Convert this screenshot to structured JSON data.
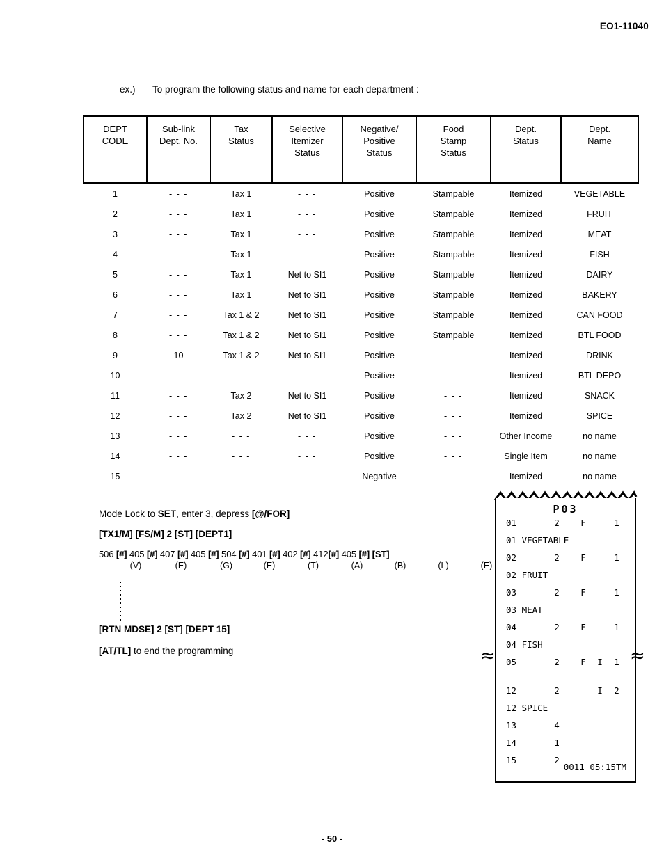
{
  "header": {
    "doc_code": "EO1-11040"
  },
  "intro": {
    "label": "ex.)",
    "text": "To program the following status and name for each department :"
  },
  "table": {
    "columns": [
      {
        "lines": [
          "DEPT",
          "CODE"
        ]
      },
      {
        "lines": [
          "Sub-link",
          "Dept. No."
        ]
      },
      {
        "lines": [
          "Tax",
          "Status"
        ]
      },
      {
        "lines": [
          "Selective",
          "Itemizer",
          "Status"
        ]
      },
      {
        "lines": [
          "Negative/",
          "Positive",
          "Status"
        ]
      },
      {
        "lines": [
          "Food",
          "Stamp",
          "Status"
        ]
      },
      {
        "lines": [
          "Dept.",
          "Status"
        ]
      },
      {
        "lines": [
          "Dept.",
          "Name"
        ]
      }
    ],
    "rows": [
      [
        "1",
        "- - -",
        "Tax 1",
        "- - -",
        "Positive",
        "Stampable",
        "Itemized",
        "VEGETABLE"
      ],
      [
        "2",
        "- - -",
        "Tax 1",
        "- - -",
        "Positive",
        "Stampable",
        "Itemized",
        "FRUIT"
      ],
      [
        "3",
        "- - -",
        "Tax 1",
        "- - -",
        "Positive",
        "Stampable",
        "Itemized",
        "MEAT"
      ],
      [
        "4",
        "- - -",
        "Tax 1",
        "- - -",
        "Positive",
        "Stampable",
        "Itemized",
        "FISH"
      ],
      [
        "5",
        "- - -",
        "Tax 1",
        "Net to SI1",
        "Positive",
        "Stampable",
        "Itemized",
        "DAIRY"
      ],
      [
        "6",
        "- - -",
        "Tax 1",
        "Net to SI1",
        "Positive",
        "Stampable",
        "Itemized",
        "BAKERY"
      ],
      [
        "7",
        "- - -",
        "Tax 1 & 2",
        "Net to SI1",
        "Positive",
        "Stampable",
        "Itemized",
        "CAN FOOD"
      ],
      [
        "8",
        "- - -",
        "Tax 1 & 2",
        "Net to SI1",
        "Positive",
        "Stampable",
        "Itemized",
        "BTL FOOD"
      ],
      [
        "9",
        "10",
        "Tax 1 & 2",
        "Net to SI1",
        "Positive",
        "- - -",
        "Itemized",
        "DRINK"
      ],
      [
        "10",
        "- - -",
        "- - -",
        "- - -",
        "Positive",
        "- - -",
        "Itemized",
        "BTL DEPO"
      ],
      [
        "11",
        "- - -",
        "Tax 2",
        "Net to SI1",
        "Positive",
        "- - -",
        "Itemized",
        "SNACK"
      ],
      [
        "12",
        "- - -",
        "Tax 2",
        "Net to SI1",
        "Positive",
        "- - -",
        "Itemized",
        "SPICE"
      ],
      [
        "13",
        "- - -",
        "- - -",
        "- - -",
        "Positive",
        "- - -",
        "Other Income",
        "no name"
      ],
      [
        "14",
        "- - -",
        "- - -",
        "- - -",
        "Positive",
        "- - -",
        "Single Item",
        "no name"
      ],
      [
        "15",
        "- - -",
        "- - -",
        "- - -",
        "Negative",
        "- - -",
        "Itemized",
        "no name"
      ]
    ]
  },
  "procedure": {
    "line1_prefix": "Mode Lock to ",
    "line1_bold1": "SET",
    "line1_mid": ", enter 3, depress ",
    "line1_bold2": "[@/FOR]",
    "line2": "[TX1/M] [FS/M] 2 [ST] [DEPT1]",
    "keyseq": "506 [#] 405 [#] 407 [#] 405 [#] 504 [#] 401 [#] 402 [#] 412[#] 405 [#] [ST]",
    "letters": [
      "(V)",
      "(E)",
      "(G)",
      "(E)",
      "(T)",
      "(A)",
      "(B)",
      "(L)",
      "(E)"
    ],
    "line4": "[RTN MDSE]  2 [ST] [DEPT 15]",
    "line5_bold": "[AT/TL]",
    "line5_rest": " to end the programming"
  },
  "receipt": {
    "title": "P03",
    "rows": [
      {
        "code": "01",
        "qty": "2",
        "flag": "F",
        "si": "",
        "num": "1"
      },
      {
        "name": "01 VEGETABLE"
      },
      {
        "code": "02",
        "qty": "2",
        "flag": "F",
        "si": "",
        "num": "1"
      },
      {
        "name": "02 FRUIT"
      },
      {
        "code": "03",
        "qty": "2",
        "flag": "F",
        "si": "",
        "num": "1"
      },
      {
        "name": "03 MEAT"
      },
      {
        "code": "04",
        "qty": "2",
        "flag": "F",
        "si": "",
        "num": "1"
      },
      {
        "name": "04 FISH"
      },
      {
        "code": "05",
        "qty": "2",
        "flag": "F",
        "si": "I",
        "num": "1"
      }
    ],
    "rows_after_break": [
      {
        "code": "12",
        "qty": "2",
        "flag": "",
        "si": "I",
        "num": "2"
      },
      {
        "name": "12 SPICE"
      },
      {
        "code": "13",
        "qty": "4",
        "flag": "",
        "si": "",
        "num": ""
      },
      {
        "code": "14",
        "qty": "1",
        "flag": "",
        "si": "",
        "num": ""
      },
      {
        "code": "15",
        "qty": "2",
        "flag": "",
        "si": "",
        "num": ""
      }
    ],
    "footer": "0011 05:15TM",
    "break_mark": "≈"
  },
  "footer": {
    "page": "- 50 -"
  }
}
